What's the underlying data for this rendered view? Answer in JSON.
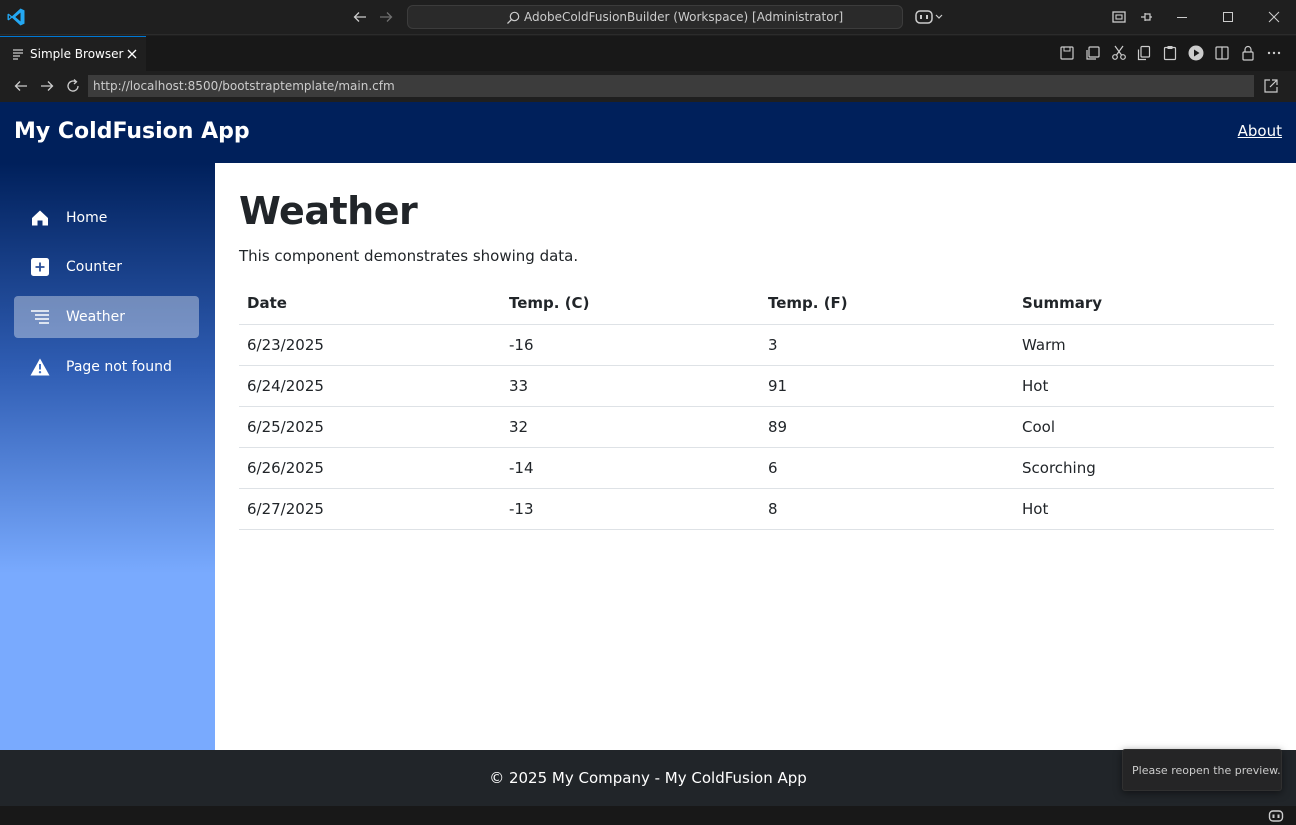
{
  "titlebar": {
    "command_center_text": "AdobeColdFusionBuilder (Workspace) [Administrator]"
  },
  "tab": {
    "label": "Simple Browser"
  },
  "address": {
    "url": "http://localhost:8500/bootstraptemplate/main.cfm"
  },
  "app": {
    "brand": "My ColdFusion App",
    "about_link": "About"
  },
  "sidebar": {
    "items": [
      {
        "label": "Home",
        "icon": "home-icon"
      },
      {
        "label": "Counter",
        "icon": "plus-square-icon"
      },
      {
        "label": "Weather",
        "icon": "list-icon",
        "active": true
      },
      {
        "label": "Page not found",
        "icon": "warning-icon"
      }
    ]
  },
  "main": {
    "title": "Weather",
    "description": "This component demonstrates showing data.",
    "table": {
      "headers": [
        "Date",
        "Temp. (C)",
        "Temp. (F)",
        "Summary"
      ],
      "rows": [
        [
          "6/23/2025",
          "-16",
          "3",
          "Warm"
        ],
        [
          "6/24/2025",
          "33",
          "91",
          "Hot"
        ],
        [
          "6/25/2025",
          "32",
          "89",
          "Cool"
        ],
        [
          "6/26/2025",
          "-14",
          "6",
          "Scorching"
        ],
        [
          "6/27/2025",
          "-13",
          "8",
          "Hot"
        ]
      ]
    }
  },
  "footer": {
    "text": "© 2025 My Company - My ColdFusion App"
  },
  "toast": {
    "message": "Please reopen the preview."
  },
  "colors": {
    "navbar": "#00205b",
    "sidebar_bottom": "#79aafe",
    "footer": "#212529",
    "vscode_accent": "#0078d4"
  }
}
